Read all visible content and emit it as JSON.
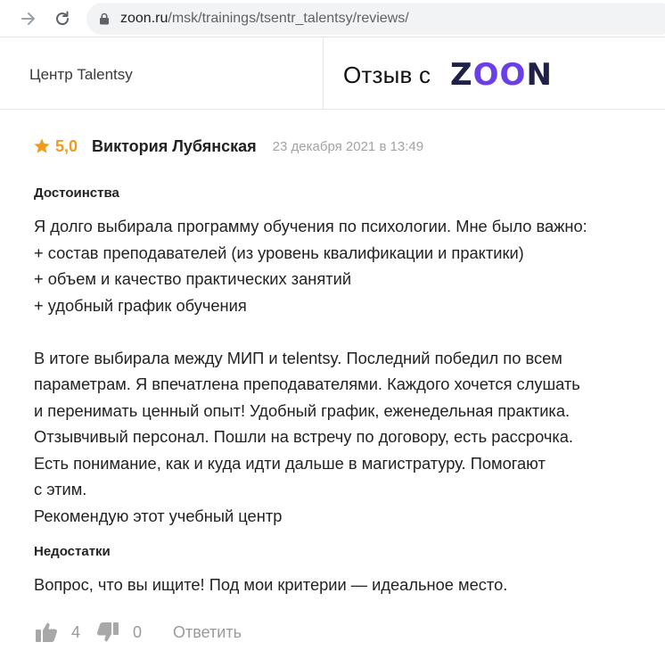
{
  "browser": {
    "url_domain": "zoon.ru",
    "url_path": "/msk/trainings/tsentr_talentsy/reviews/",
    "forward_icon": "arrow-forward-icon",
    "reload_icon": "reload-icon",
    "lock_icon": "lock-icon"
  },
  "header": {
    "org_name": "Центр Talentsy",
    "review_from": "Отзыв с",
    "logo_z": "Z",
    "logo_oo": "OO",
    "logo_n": "N"
  },
  "review": {
    "rating": "5,0",
    "author": "Виктория Лубянская",
    "date": "23 декабря 2021 в 13:49",
    "pros_title": "Достоинства",
    "pros_text": "Я долго выбирала программу обучения по психологии. Мне было важно:\n+ состав преподавателей (из уровень квалификации и практики)\n+ объем и качество практических занятий\n+ удобный график обучения\n\nВ итоге выбирала между МИП и telentsy. Последний победил по всем\nпараметрам. Я впечатлена преподавателями. Каждого хочется слушать\nи перенимать ценный опыт! Удобный график, еженедельная практика.\nОтзывчивый персонал. Пошли на встречу по договору, есть рассрочка.\nЕсть понимание, как и куда идти дальше в магистратуру. Помогают\nс этим.\nРекомендую этот учебный центр",
    "cons_title": "Недостатки",
    "cons_text": "Вопрос, что вы ищите! Под мои критерии — идеальное место."
  },
  "actions": {
    "likes": "4",
    "dislikes": "0",
    "reply_label": "Ответить"
  },
  "colors": {
    "accent_star": "#f29a1b",
    "logo_dark": "#1f2148",
    "logo_purple": "#6a3fe8",
    "muted": "#9a9a9a"
  }
}
